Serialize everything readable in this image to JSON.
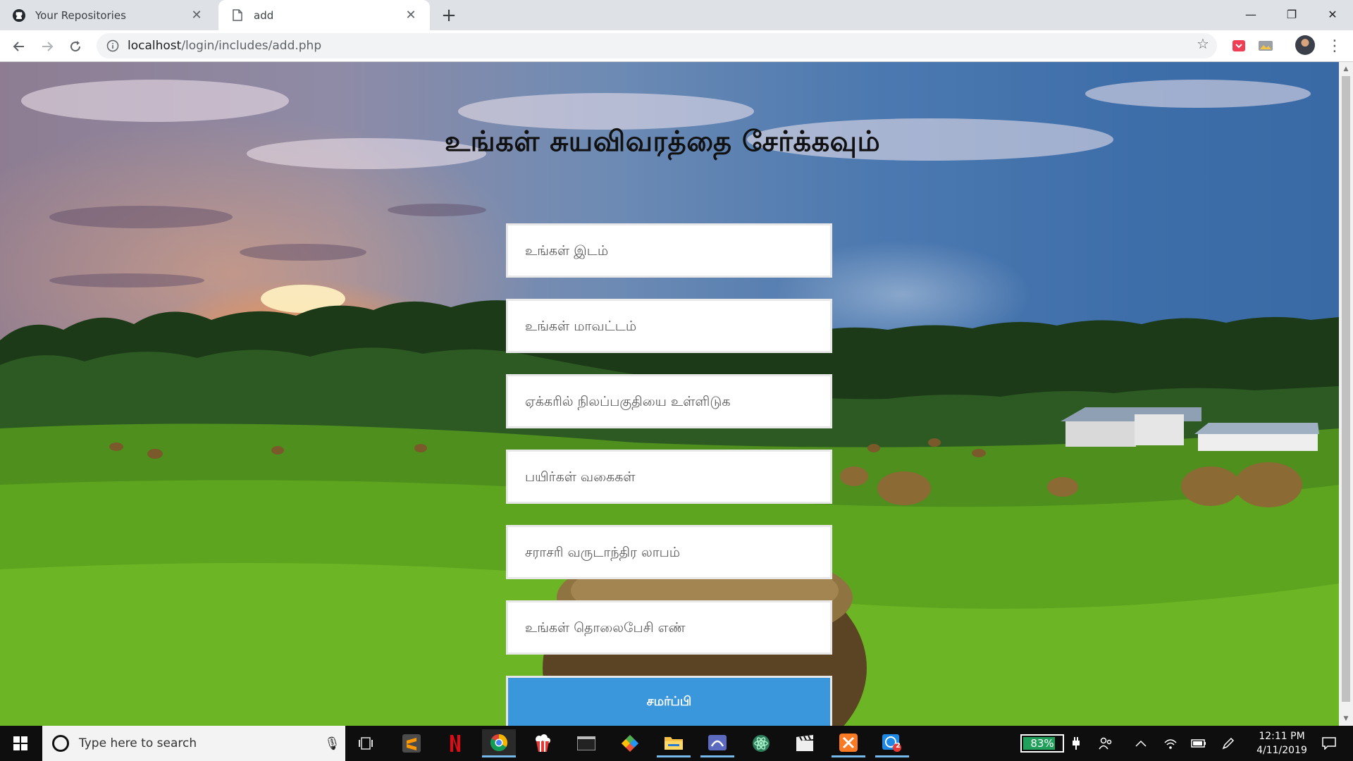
{
  "browser": {
    "tabs": [
      {
        "title": "Your Repositories",
        "active": false
      },
      {
        "title": "add",
        "active": true
      }
    ],
    "address": {
      "host": "localhost",
      "path": "/login/includes/add.php"
    }
  },
  "page": {
    "title": "உங்கள் சுயவிவரத்தை சேர்க்கவும்",
    "fields": [
      {
        "placeholder": "உங்கள் இடம்",
        "value": ""
      },
      {
        "placeholder": "உங்கள் மாவட்டம்",
        "value": ""
      },
      {
        "placeholder": "ஏக்கரில் நிலப்பகுதியை உள்ளிடுக",
        "value": ""
      },
      {
        "placeholder": "பயிர்கள் வகைகள்",
        "value": ""
      },
      {
        "placeholder": "சராசரி வருடாந்திர லாபம்",
        "value": ""
      },
      {
        "placeholder": "உங்கள் தொலைபேசி எண்",
        "value": ""
      }
    ],
    "submit_label": "சமர்ப்பி",
    "submit_color": "#3b97dc"
  },
  "taskbar": {
    "search_placeholder": "Type here to search",
    "battery_percent": "83%",
    "battery_level": 0.83,
    "time": "12:11 PM",
    "date": "4/11/2019",
    "badge_count": "2",
    "apps": [
      "task-view-icon",
      "sublime-text-icon",
      "netflix-icon",
      "chrome-icon",
      "popcorn-icon",
      "terminal-icon",
      "git-icon",
      "file-explorer-icon",
      "studio-icon",
      "atom-icon",
      "clapper-icon",
      "xampp-icon",
      "whatsapp-icon"
    ]
  },
  "colors": {
    "accent": "#3b97dc",
    "tab_strip": "#dee1e6",
    "taskbar": "#0e0e0e"
  }
}
